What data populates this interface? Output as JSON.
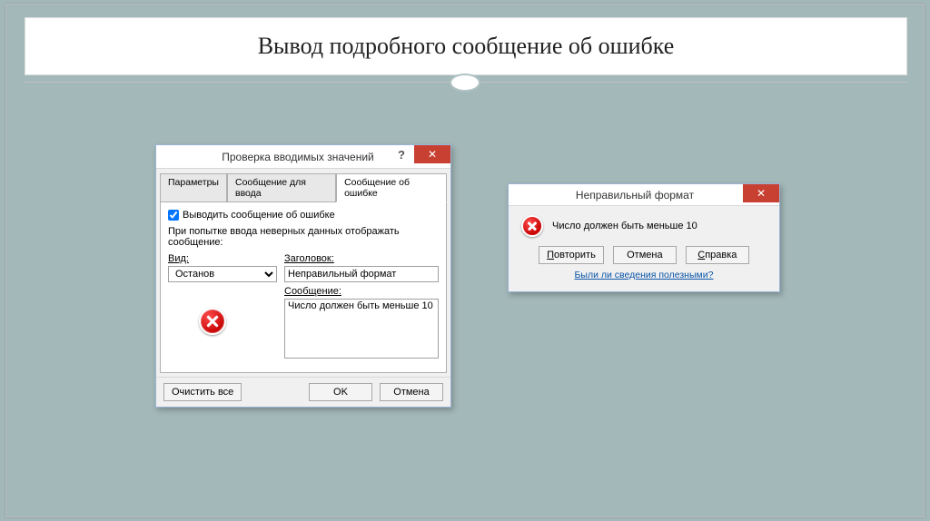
{
  "slide": {
    "title": "Вывод подробного сообщение об ошибке"
  },
  "dialog1": {
    "title": "Проверка вводимых значений",
    "tabs": [
      "Параметры",
      "Сообщение для ввода",
      "Сообщение об ошибке"
    ],
    "checkbox_label": "Выводить сообщение об ошибке",
    "hint": "При попытке ввода неверных данных отображать сообщение:",
    "labels": {
      "type": "Вид:",
      "title_field": "Заголовок:",
      "message": "Сообщение:"
    },
    "values": {
      "type": "Останов",
      "title_field": "Неправильный формат",
      "message": "Число должен быть меньше 10"
    },
    "buttons": {
      "clear": "Очистить все",
      "ok": "OK",
      "cancel": "Отмена"
    }
  },
  "dialog2": {
    "title": "Неправильный формат",
    "message": "Число должен быть меньше 10",
    "buttons": {
      "retry": "Повторить",
      "cancel": "Отмена",
      "help": "Справка"
    },
    "link": "Были ли сведения полезными?"
  }
}
